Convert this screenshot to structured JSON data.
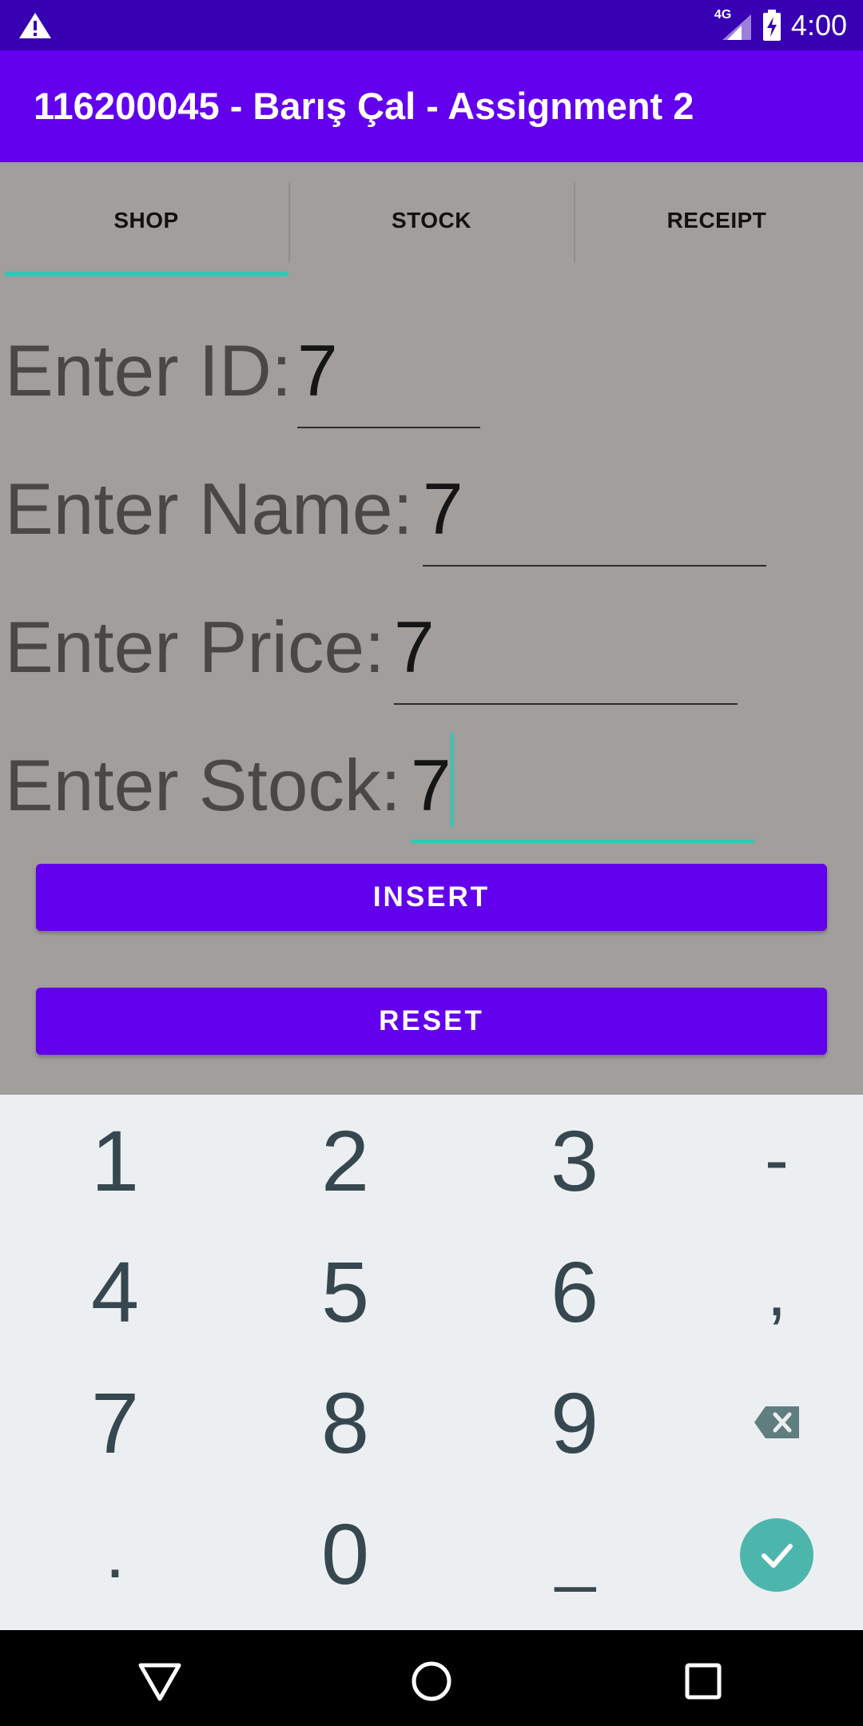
{
  "status_bar": {
    "network": "4G",
    "time": "4:00",
    "icons": [
      "warning-icon",
      "signal-icon",
      "battery-charging-icon"
    ]
  },
  "app_bar": {
    "title": "116200045 - Barış Çal - Assignment 2"
  },
  "tabs": [
    {
      "label": "SHOP",
      "selected": true
    },
    {
      "label": "STOCK",
      "selected": false
    },
    {
      "label": "RECEIPT",
      "selected": false
    }
  ],
  "form": {
    "id": {
      "label": "Enter ID:",
      "value": "7"
    },
    "name": {
      "label": "Enter Name:",
      "value": "7"
    },
    "price": {
      "label": "Enter Price:",
      "value": "7"
    },
    "stock": {
      "label": "Enter Stock:",
      "value": "7",
      "focused": true
    }
  },
  "buttons": {
    "insert": "INSERT",
    "reset": "RESET"
  },
  "keypad": {
    "k1": "1",
    "k2": "2",
    "k3": "3",
    "minus": "-",
    "k4": "4",
    "k5": "5",
    "k6": "6",
    "comma": ",",
    "k7": "7",
    "k8": "8",
    "k9": "9",
    "dot": ".",
    "k0": "0",
    "space": "_",
    "icons": [
      "backspace-icon",
      "check-icon"
    ]
  },
  "colors": {
    "status_bar": "#3700b3",
    "primary": "#6200ee",
    "accent": "#35c6b6",
    "enter_key": "#4db6ac"
  }
}
